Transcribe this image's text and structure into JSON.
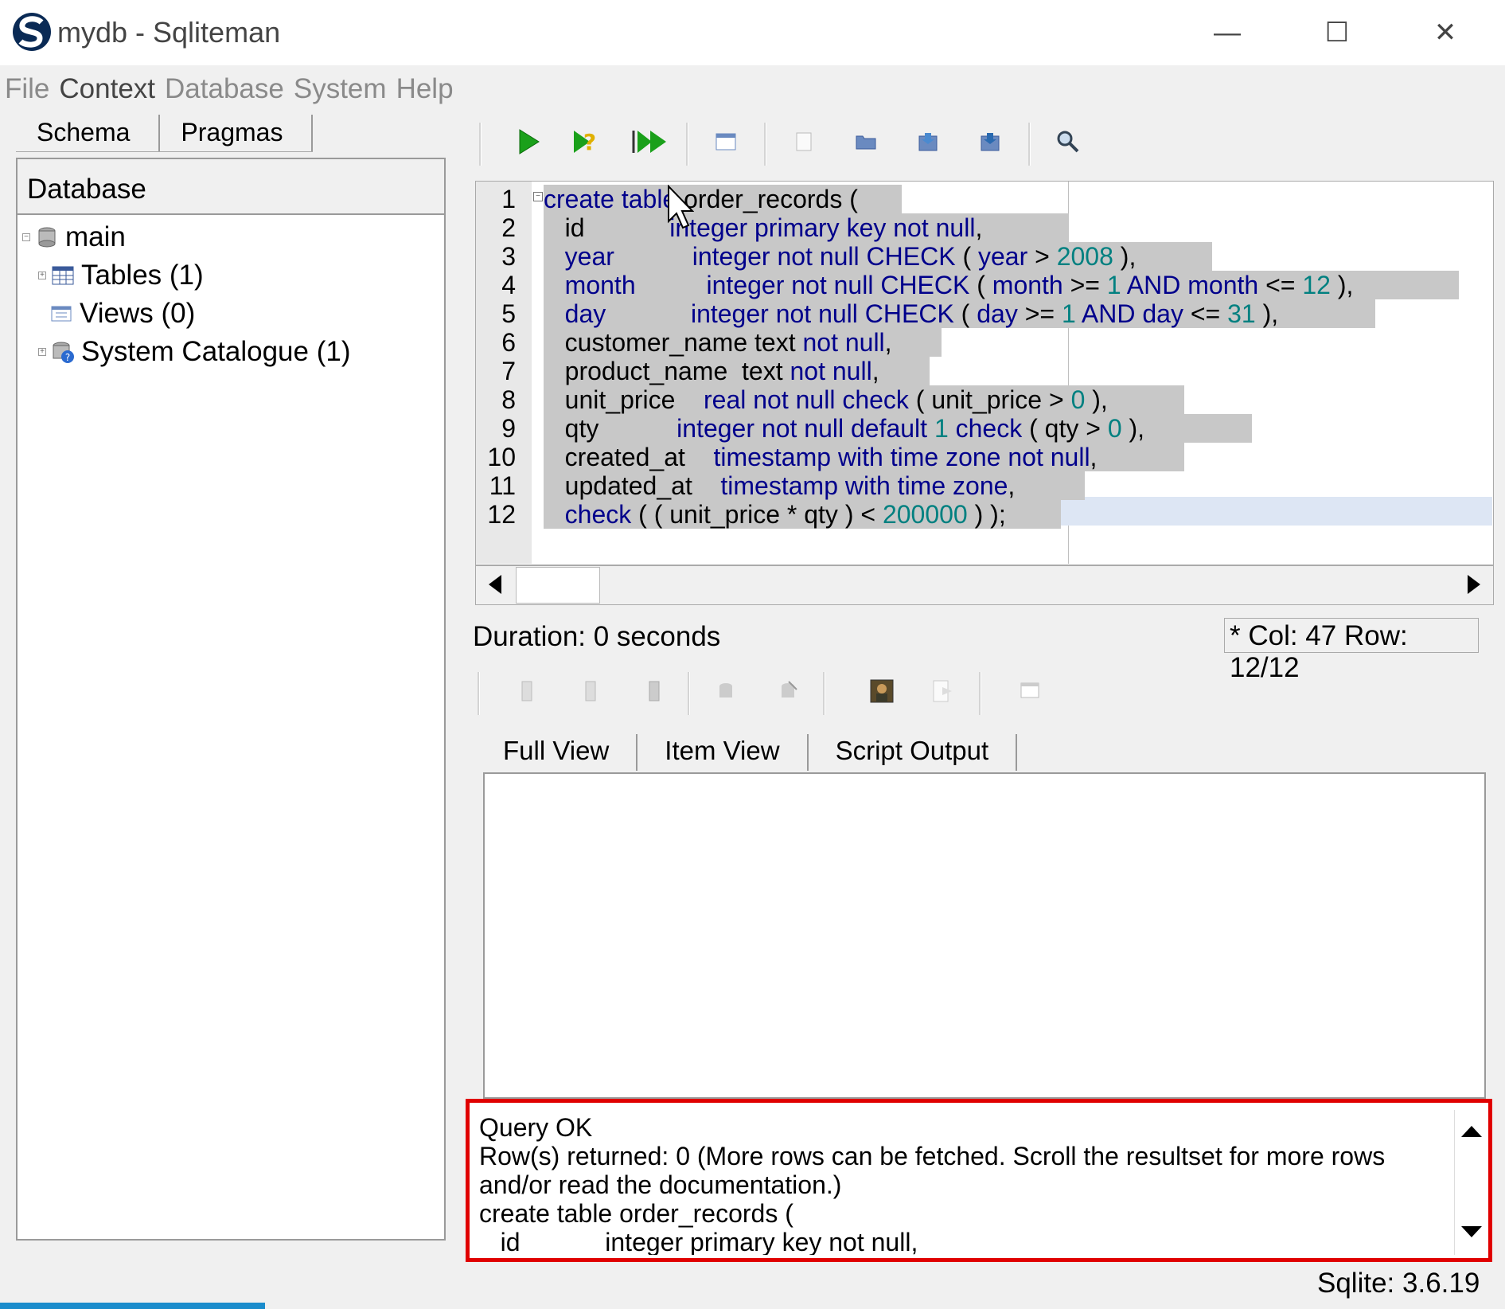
{
  "window": {
    "title": "mydb - Sqliteman",
    "minimize": "—",
    "maximize": "☐",
    "close": "✕"
  },
  "menu": [
    "File",
    "Context",
    "Database",
    "System",
    "Help"
  ],
  "left": {
    "tabs": [
      "Schema",
      "Pragmas"
    ],
    "header": "Database",
    "tree": {
      "root": "main",
      "children": [
        "Tables (1)",
        "Views (0)",
        "System Catalogue (1)"
      ]
    }
  },
  "editor": {
    "line_numbers": [
      "1",
      "2",
      "3",
      "4",
      "5",
      "6",
      "7",
      "8",
      "9",
      "10",
      "11",
      "12"
    ],
    "lines": [
      [
        {
          "t": "create table",
          "k": 1
        },
        {
          "t": " order_records (",
          "k": 0
        }
      ],
      [
        {
          "t": "   id            ",
          "k": 0
        },
        {
          "t": "integer primary key not null",
          "k": 1
        },
        {
          "t": ",",
          "k": 0
        }
      ],
      [
        {
          "t": "   year           ",
          "k": 1
        },
        {
          "t": "integer not null CHECK",
          "k": 1
        },
        {
          "t": " ( ",
          "k": 0
        },
        {
          "t": "year",
          "k": 1
        },
        {
          "t": " > ",
          "k": 0
        },
        {
          "t": "2008",
          "k": 2
        },
        {
          "t": " ),",
          "k": 0
        }
      ],
      [
        {
          "t": "   month          ",
          "k": 1
        },
        {
          "t": "integer not null CHECK",
          "k": 1
        },
        {
          "t": " ( ",
          "k": 0
        },
        {
          "t": "month",
          "k": 1
        },
        {
          "t": " >= ",
          "k": 0
        },
        {
          "t": "1",
          "k": 2
        },
        {
          "t": " ",
          "k": 0
        },
        {
          "t": "AND month",
          "k": 1
        },
        {
          "t": " <= ",
          "k": 0
        },
        {
          "t": "12",
          "k": 2
        },
        {
          "t": " ),",
          "k": 0
        }
      ],
      [
        {
          "t": "   day            ",
          "k": 1
        },
        {
          "t": "integer not null CHECK",
          "k": 1
        },
        {
          "t": " ( ",
          "k": 0
        },
        {
          "t": "day",
          "k": 1
        },
        {
          "t": " >= ",
          "k": 0
        },
        {
          "t": "1",
          "k": 2
        },
        {
          "t": " ",
          "k": 0
        },
        {
          "t": "AND day",
          "k": 1
        },
        {
          "t": " <= ",
          "k": 0
        },
        {
          "t": "31",
          "k": 2
        },
        {
          "t": " ),",
          "k": 0
        }
      ],
      [
        {
          "t": "   customer_name text ",
          "k": 0
        },
        {
          "t": "not null",
          "k": 1
        },
        {
          "t": ",",
          "k": 0
        }
      ],
      [
        {
          "t": "   product_name  text ",
          "k": 0
        },
        {
          "t": "not null",
          "k": 1
        },
        {
          "t": ",",
          "k": 0
        }
      ],
      [
        {
          "t": "   unit_price    ",
          "k": 0
        },
        {
          "t": "real not null check",
          "k": 1
        },
        {
          "t": " ( unit_price > ",
          "k": 0
        },
        {
          "t": "0",
          "k": 2
        },
        {
          "t": " ),",
          "k": 0
        }
      ],
      [
        {
          "t": "   qty           ",
          "k": 0
        },
        {
          "t": "integer not null default",
          "k": 1
        },
        {
          "t": " ",
          "k": 0
        },
        {
          "t": "1",
          "k": 2
        },
        {
          "t": " ",
          "k": 0
        },
        {
          "t": "check",
          "k": 1
        },
        {
          "t": " ( qty > ",
          "k": 0
        },
        {
          "t": "0",
          "k": 2
        },
        {
          "t": " ),",
          "k": 0
        }
      ],
      [
        {
          "t": "   created_at    ",
          "k": 0
        },
        {
          "t": "timestamp with time zone not null",
          "k": 1
        },
        {
          "t": ",",
          "k": 0
        }
      ],
      [
        {
          "t": "   updated_at    ",
          "k": 0
        },
        {
          "t": "timestamp with time zone",
          "k": 1
        },
        {
          "t": ",",
          "k": 0
        }
      ],
      [
        {
          "t": "   ",
          "k": 0
        },
        {
          "t": "check",
          "k": 1
        },
        {
          "t": " ( ( unit_price * qty ) < ",
          "k": 0
        },
        {
          "t": "200000",
          "k": 2
        },
        {
          "t": " ) );",
          "k": 0
        }
      ]
    ]
  },
  "status": {
    "duration": "Duration: 0 seconds",
    "caret": "* Col: 47 Row: 12/12"
  },
  "result_tabs": [
    "Full View",
    "Item View",
    "Script Output"
  ],
  "output": {
    "text": "Query OK\nRow(s) returned: 0 (More rows can be fetched. Scroll the resultset for more rows and/or read the documentation.)\ncreate table order_records (\n   id            integer primary key not null,"
  },
  "footer": {
    "version": "Sqlite: 3.6.19"
  },
  "colors": {
    "keyword": "#00008b",
    "number": "#008080",
    "highlight_border": "#e00000",
    "selection": "#c8c8c8"
  }
}
